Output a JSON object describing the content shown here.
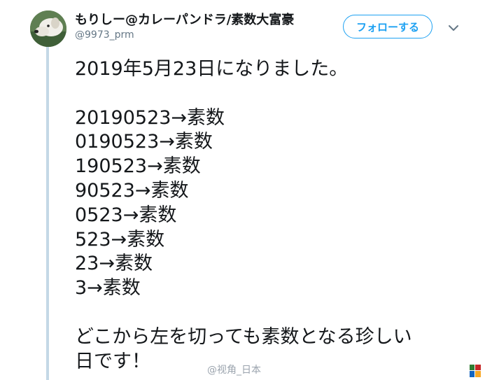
{
  "tweet": {
    "display_name": "もりしー@カレーパンドラ/素数大富豪",
    "handle": "@9973_prm",
    "follow_label": "フォローする",
    "date_line": "2019年5月23日になりました。",
    "prime_lines": [
      "20190523→素数",
      "0190523→素数",
      "190523→素数",
      "90523→素数",
      "0523→素数",
      "523→素数",
      "23→素数",
      "3→素数"
    ],
    "closing_line_1": "どこから左を切っても素数となる珍しい",
    "closing_line_2": "日です！"
  },
  "watermark": "@视角_日本",
  "colors": {
    "accent": "#1da1f2",
    "text": "#14171a",
    "muted": "#657786",
    "thread_line": "#c4d8e6"
  },
  "icons": {
    "avatar": "dog-photo-avatar",
    "menu": "chevron-down-icon"
  }
}
